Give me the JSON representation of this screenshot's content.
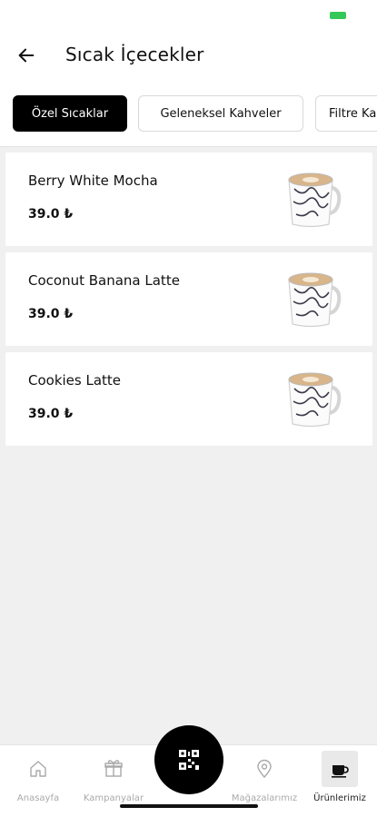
{
  "header": {
    "title": "Sıcak İçecekler"
  },
  "tabs": [
    {
      "label": "Özel Sıcaklar",
      "active": true
    },
    {
      "label": "Geleneksel Kahveler",
      "active": false
    },
    {
      "label": "Filtre Kahveler",
      "active": false
    }
  ],
  "products": [
    {
      "name": "Berry White Mocha",
      "price": "39.0 ₺"
    },
    {
      "name": "Coconut Banana Latte",
      "price": "39.0 ₺"
    },
    {
      "name": "Cookies Latte",
      "price": "39.0 ₺"
    }
  ],
  "nav": {
    "home": "Anasayfa",
    "campaigns": "Kampanyalar",
    "stores": "Mağazalarımız",
    "products": "Ürünlerimiz"
  },
  "colors": {
    "accent": "#000000",
    "inactive": "#a9a9a9",
    "battery": "#34c759"
  }
}
